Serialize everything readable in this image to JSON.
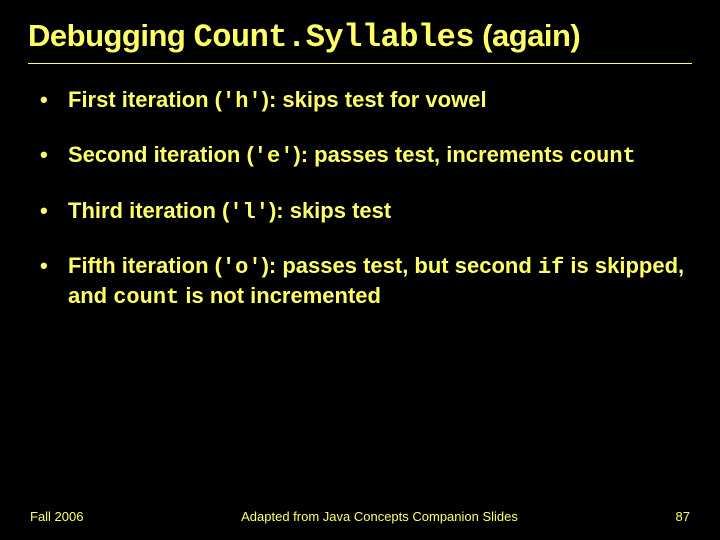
{
  "title": {
    "pre": "Debugging ",
    "code": "Count.Syllables",
    "post": " (again)"
  },
  "bullets": [
    {
      "pre": "First iteration (",
      "code1": "'h'",
      "mid": "): skips test for vowel",
      "code2": "",
      "post": ""
    },
    {
      "pre": "Second iteration (",
      "code1": "'e'",
      "mid": "): passes test, increments ",
      "code2": "count",
      "post": ""
    },
    {
      "pre": "Third iteration (",
      "code1": "'l'",
      "mid": "): skips test",
      "code2": "",
      "post": ""
    },
    {
      "pre": "Fifth iteration (",
      "code1": "'o'",
      "mid": "): passes test, but second ",
      "code2": "if",
      "post_mid": " is skipped, and ",
      "code3": "count",
      "post": " is not incremented"
    }
  ],
  "footer": {
    "left": "Fall 2006",
    "center": "Adapted from Java Concepts Companion Slides",
    "right": "87"
  }
}
